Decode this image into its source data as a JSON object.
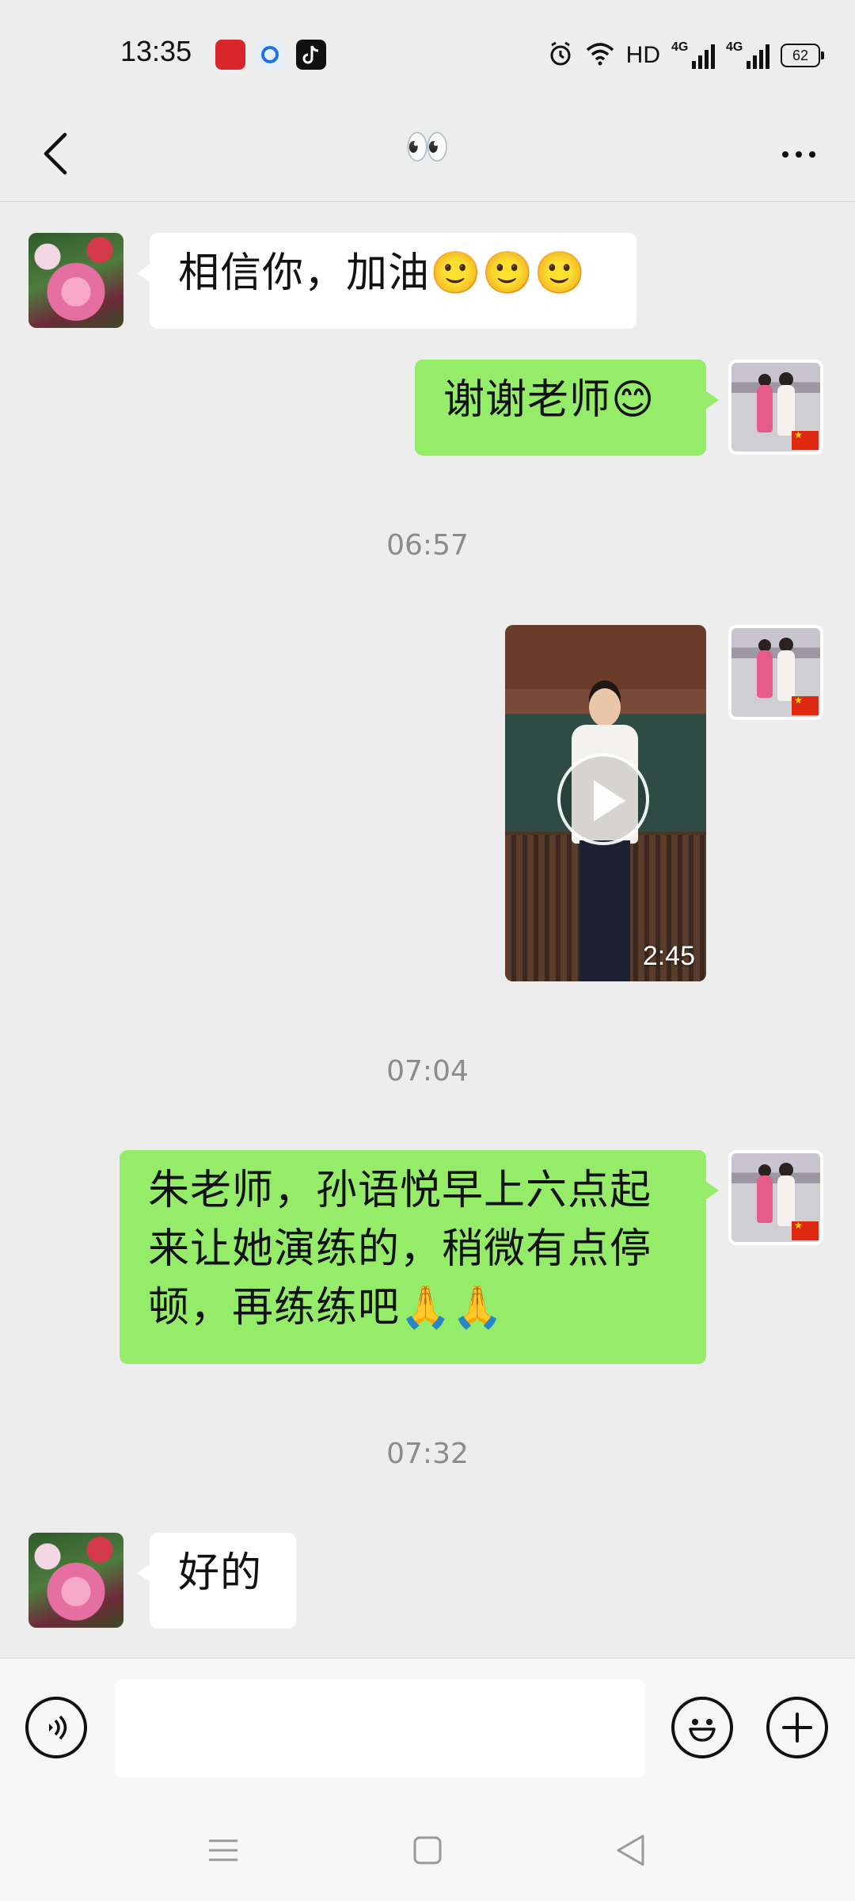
{
  "status_bar": {
    "time": "13:35",
    "hd_label": "HD",
    "network_label_1": "4G",
    "network_label_2": "4G",
    "battery": "62",
    "notification_icons": [
      "calendar-app-icon",
      "browser-app-icon",
      "tiktok-app-icon"
    ]
  },
  "header": {
    "title": "👀"
  },
  "messages": [
    {
      "side": "left",
      "type": "text",
      "text": "相信你，加油🙂🙂🙂"
    },
    {
      "side": "right",
      "type": "text",
      "text": "谢谢老师😊"
    },
    {
      "type": "timestamp",
      "text": "06:57"
    },
    {
      "side": "right",
      "type": "video",
      "duration": "2:45"
    },
    {
      "type": "timestamp",
      "text": "07:04"
    },
    {
      "side": "right",
      "type": "text",
      "text": "朱老师，孙语悦早上六点起来让她演练的，稍微有点停顿，再练练吧🙏🙏"
    },
    {
      "type": "timestamp",
      "text": "07:32"
    },
    {
      "side": "left",
      "type": "text",
      "text": "好的"
    }
  ],
  "input": {
    "value": ""
  },
  "colors": {
    "background": "#ededed",
    "outgoing_bubble": "#95ec69",
    "incoming_bubble": "#ffffff",
    "timestamp": "#8c8c8c"
  }
}
